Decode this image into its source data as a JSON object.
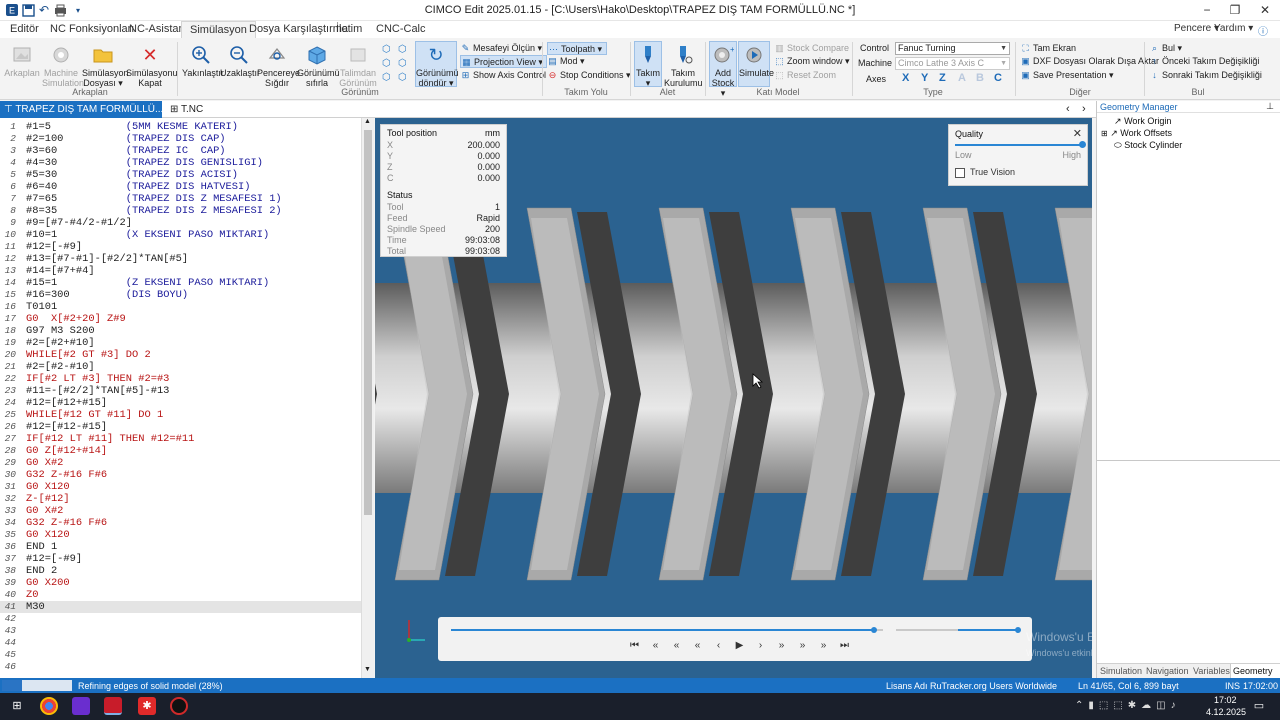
{
  "window": {
    "title": "CIMCO Edit 2025.01.15 - [C:\\Users\\Hako\\Desktop\\TRAPEZ DIŞ TAM FORMÜLLÜ.NC *]",
    "minimize": "−",
    "restore": "❐",
    "close": "✕",
    "menu_help": "Pencere ▾",
    "menu_yardim": "Yardım ▾"
  },
  "menus": [
    "Editör",
    "NC Fonksiyonları",
    "NC-Asistan",
    "Simülasyon",
    "Dosya Karşılaştırma",
    "İletim",
    "CNC-Calc"
  ],
  "ribbon": {
    "arkaplan": {
      "label": "Arkaplan",
      "group": "Arkaplan"
    },
    "machine_sim": {
      "label1": "Machine",
      "label2": "Simulation"
    },
    "sim_dosya": {
      "label1": "Simülasyon",
      "label2": "Dosyası ▾"
    },
    "sim_kapat": {
      "label1": "Simülasyonu",
      "label2": "Kapat"
    },
    "yakinlastir": "Yakınlaştır",
    "uzaklastir": "Uzaklaştır",
    "pencereye": {
      "label1": "Pencereye",
      "label2": "Sığdır"
    },
    "gorunumu_sifirla": {
      "label1": "Görünümü",
      "label2": "sıfırla"
    },
    "talimdan": {
      "label1": "Talimdan",
      "label2": "Görünüm"
    },
    "gorunumu_dondur": {
      "label1": "Görünümü",
      "label2": "döndür ▾"
    },
    "gorunum_group": "Görünüm",
    "mesafeyi_olcun": "Mesafeyi Ölçün ▾",
    "projection_view": "Projection View ▾",
    "show_axis": "Show Axis Control",
    "toolpath": "Toolpath ▾",
    "mod": "Mod ▾",
    "stop_conditions": "Stop Conditions ▾",
    "takim_yolu_group": "Takım Yolu",
    "takim": {
      "label1": "Takım",
      "label2": "▾"
    },
    "takim_kurulumu": {
      "label1": "Takım",
      "label2": "Kurulumu"
    },
    "alet_group": "Alet",
    "add_stock": {
      "label1": "Add",
      "label2": "Stock ▾"
    },
    "simulate": "Simulate",
    "stock_compare": "Stock Compare",
    "zoom_window": "Zoom window ▾",
    "reset_zoom": "Reset Zoom",
    "kati_model_group": "Katı Model",
    "control_label": "Control",
    "control_value": "Fanuc Turning",
    "machine_label": "Machine",
    "machine_value": "Cimco Lathe 3 Axis C",
    "axes_label": "Axes",
    "axes": [
      "X",
      "Y",
      "Z",
      "A",
      "B",
      "C"
    ],
    "type_group": "Type",
    "tam_ekran": "Tam Ekran",
    "dxf": "DXF Dosyası Olarak Dışa Aktar",
    "save_presentation": "Save Presentation ▾",
    "diger_group": "Diğer",
    "bul": "Bul ▾",
    "onceki_takim": "Önceki Takım Değişikliği",
    "sonraki_takim": "Sonraki Takım Değişikliği",
    "bul_group": "Bul"
  },
  "tabs": {
    "doc1": "TRAPEZ DIŞ TAM FORMÜLLÜ....",
    "doc2": "T.NC",
    "doc1_close": "✕"
  },
  "code_lines": [
    {
      "n": "1",
      "code": "#1=5",
      "comment": "(5MM KESME KATERI)",
      "kw": false
    },
    {
      "n": "2",
      "code": "#2=100",
      "comment": "(TRAPEZ DIS CAP)",
      "kw": false
    },
    {
      "n": "3",
      "code": "#3=60",
      "comment": "(TRAPEZ IC  CAP)",
      "kw": false
    },
    {
      "n": "4",
      "code": "#4=30",
      "comment": "(TRAPEZ DIS GENISLIGI)",
      "kw": false
    },
    {
      "n": "5",
      "code": "#5=30",
      "comment": "(TRAPEZ DIS ACISI)",
      "kw": false
    },
    {
      "n": "6",
      "code": "#6=40",
      "comment": "(TRAPEZ DIS HATVESI)",
      "kw": false
    },
    {
      "n": "7",
      "code": "#7=65",
      "comment": "(TRAPEZ DIS Z MESAFESI 1)",
      "kw": false
    },
    {
      "n": "8",
      "code": "#8=35",
      "comment": "(TRAPEZ DIS Z MESAFESI 2)",
      "kw": false
    },
    {
      "n": "9",
      "code": "#9=[#7-#4/2-#1/2]",
      "comment": "",
      "kw": false
    },
    {
      "n": "10",
      "code": "#10=1",
      "comment": "(X EKSENI PASO MIKTARI)",
      "kw": false
    },
    {
      "n": "11",
      "code": "#12=[-#9]",
      "comment": "",
      "kw": false
    },
    {
      "n": "12",
      "code": "#13=[#7-#1]-[#2/2]*TAN[#5]",
      "comment": "",
      "kw": false
    },
    {
      "n": "13",
      "code": "#14=[#7+#4]",
      "comment": "",
      "kw": false
    },
    {
      "n": "14",
      "code": "#15=1",
      "comment": "(Z EKSENI PASO MIKTARI)",
      "kw": false
    },
    {
      "n": "15",
      "code": "#16=300",
      "comment": "(DIS BOYU)",
      "kw": false
    },
    {
      "n": "16",
      "code": "T0101",
      "comment": "",
      "kw": false
    },
    {
      "n": "17",
      "code": "G0  X[#2+20] Z#9",
      "comment": "",
      "kw": true
    },
    {
      "n": "18",
      "code": "G97 M3 S200",
      "comment": "",
      "kw": false
    },
    {
      "n": "19",
      "code": "#2=[#2+#10]",
      "comment": "",
      "kw": false
    },
    {
      "n": "20",
      "code": "WHILE[#2 GT #3] DO 2",
      "comment": "",
      "kw": true
    },
    {
      "n": "21",
      "code": "#2=[#2-#10]",
      "comment": "",
      "kw": false
    },
    {
      "n": "22",
      "code": "IF[#2 LT #3] THEN #2=#3",
      "comment": "",
      "kw": true
    },
    {
      "n": "23",
      "code": "#11=-[#2/2]*TAN[#5]-#13",
      "comment": "",
      "kw": false
    },
    {
      "n": "24",
      "code": "#12=[#12+#15]",
      "comment": "",
      "kw": false
    },
    {
      "n": "25",
      "code": "WHILE[#12 GT #11] DO 1",
      "comment": "",
      "kw": true
    },
    {
      "n": "26",
      "code": "#12=[#12-#15]",
      "comment": "",
      "kw": false
    },
    {
      "n": "27",
      "code": "IF[#12 LT #11] THEN #12=#11",
      "comment": "",
      "kw": true
    },
    {
      "n": "28",
      "code": "G0 Z[#12+#14]",
      "comment": "",
      "kw": true
    },
    {
      "n": "29",
      "code": "G0 X#2",
      "comment": "",
      "kw": true
    },
    {
      "n": "30",
      "code": "G32 Z-#16 F#6",
      "comment": "",
      "kw": true
    },
    {
      "n": "31",
      "code": "G0 X120",
      "comment": "",
      "kw": true
    },
    {
      "n": "32",
      "code": "Z-[#12]",
      "comment": "",
      "kw": true
    },
    {
      "n": "33",
      "code": "G0 X#2",
      "comment": "",
      "kw": true
    },
    {
      "n": "34",
      "code": "G32 Z-#16 F#6",
      "comment": "",
      "kw": true
    },
    {
      "n": "35",
      "code": "G0 X120",
      "comment": "",
      "kw": true
    },
    {
      "n": "36",
      "code": "END 1",
      "comment": "",
      "kw": false
    },
    {
      "n": "37",
      "code": "#12=[-#9]",
      "comment": "",
      "kw": false
    },
    {
      "n": "38",
      "code": "END 2",
      "comment": "",
      "kw": false
    },
    {
      "n": "39",
      "code": "G0 X200",
      "comment": "",
      "kw": true
    },
    {
      "n": "40",
      "code": "Z0",
      "comment": "",
      "kw": true
    },
    {
      "n": "41",
      "code": "M30",
      "comment": "",
      "kw": false
    },
    {
      "n": "42",
      "code": "",
      "comment": "",
      "kw": false
    },
    {
      "n": "43",
      "code": "",
      "comment": "",
      "kw": false
    },
    {
      "n": "44",
      "code": "",
      "comment": "",
      "kw": false
    },
    {
      "n": "45",
      "code": "",
      "comment": "",
      "kw": false
    },
    {
      "n": "46",
      "code": "",
      "comment": "",
      "kw": false
    }
  ],
  "current_line": 41,
  "tool_panel": {
    "title": "Tool position",
    "unit": "mm",
    "rows": [
      {
        "label": "X",
        "value": "200.000"
      },
      {
        "label": "Y",
        "value": "0.000"
      },
      {
        "label": "Z",
        "value": "0.000"
      },
      {
        "label": "C",
        "value": "0.000"
      }
    ],
    "status_title": "Status",
    "status_rows": [
      {
        "label": "Tool",
        "value": "1"
      },
      {
        "label": "Feed",
        "value": "Rapid"
      },
      {
        "label": "Spindle Speed",
        "value": "200"
      },
      {
        "label": "Time",
        "value": "99:03:08"
      },
      {
        "label": "Total",
        "value": "99:03:08"
      }
    ]
  },
  "quality_panel": {
    "title": "Quality",
    "low": "Low",
    "high": "High",
    "level": 1.0,
    "true_vision": "True Vision"
  },
  "playback": {
    "progress": 0.98
  },
  "watermark": {
    "line1": "Windows'u Etkinleştir",
    "line2": "Windows'u etkinleştirmek için Ayarlar'a gidin."
  },
  "geometry_manager": {
    "title": "Geometry Manager",
    "items": [
      "Work Origin",
      "Work Offsets",
      "Stock Cylinder"
    ],
    "tabs": [
      "Simulation",
      "Navigation",
      "Variables",
      "Geometry ..."
    ]
  },
  "statusbar": {
    "message": "Refining edges of solid model (28%)",
    "progress": 0.28,
    "license": "Lisans Adı RuTracker.org Users Worldwide",
    "position": "Ln 41/65, Col 6, 899 bayt",
    "mode": "INS",
    "time": "17:02:00"
  },
  "taskbar": {
    "time": "17:02",
    "date": "4.12.2025"
  },
  "colors": {
    "accent": "#1b70c2",
    "viewport_bg": "#2b6290",
    "keyword": "#b81414",
    "comment": "#1a1a9a"
  }
}
